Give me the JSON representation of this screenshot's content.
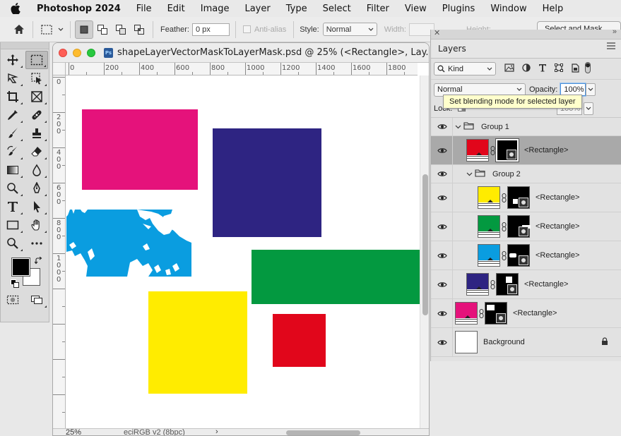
{
  "menubar": {
    "app_name": "Photoshop 2024",
    "items": [
      "File",
      "Edit",
      "Image",
      "Layer",
      "Type",
      "Select",
      "Filter",
      "View",
      "Plugins",
      "Window",
      "Help"
    ]
  },
  "options_bar": {
    "feather_label": "Feather:",
    "feather_value": "0 px",
    "antialias_label": "Anti-alias",
    "style_label": "Style:",
    "style_value": "Normal",
    "width_label": "Width:",
    "height_label": "Height:",
    "select_mask_label": "Select and Mask..."
  },
  "document": {
    "title": "shapeLayerVectorMaskToLayerMask.psd @ 25% (<Rectangle>, Lay...",
    "zoom": "25%",
    "color_profile": "eciRGB v2 (8bpc)",
    "ruler_h": [
      "0",
      "200",
      "400",
      "600",
      "800",
      "1000",
      "1200",
      "1400",
      "1600",
      "1800"
    ],
    "ruler_v": [
      "0",
      "2",
      "0",
      "0",
      "4",
      "0",
      "0",
      "6",
      "0",
      "0",
      "8",
      "0",
      "0",
      "1",
      "0",
      "0",
      "0"
    ],
    "colors": {
      "magenta": "#e5127b",
      "navy": "#2e2482",
      "cyan": "#0a9de0",
      "green": "#039940",
      "yellow": "#ffec00",
      "red": "#e1061b"
    }
  },
  "layers_panel": {
    "tab_title": "Layers",
    "filter_kind": "Kind",
    "blend_mode": "Normal",
    "opacity_label": "Opacity:",
    "opacity_value": "100%",
    "lock_label": "Lock:",
    "fill_value": "100%",
    "tooltip": "Set blending mode for selected layer",
    "layers": [
      {
        "name": "Group 1",
        "type": "group",
        "indent": 0,
        "selected": false
      },
      {
        "name": "<Rectangle>",
        "type": "shape",
        "color": "#e1061b",
        "indent": 1,
        "selected": true
      },
      {
        "name": "Group 2",
        "type": "group",
        "indent": 1,
        "selected": false
      },
      {
        "name": "<Rectangle>",
        "type": "shape",
        "color": "#ffec00",
        "indent": 2,
        "selected": false
      },
      {
        "name": "<Rectangle>",
        "type": "shape",
        "color": "#039940",
        "indent": 2,
        "selected": false
      },
      {
        "name": "<Rectangle>",
        "type": "shape",
        "color": "#0a9de0",
        "indent": 2,
        "selected": false
      },
      {
        "name": "<Rectangle>",
        "type": "shape",
        "color": "#2e2482",
        "indent": 1,
        "selected": false
      },
      {
        "name": "<Rectangle>",
        "type": "shape",
        "color": "#e5127b",
        "indent": 0,
        "selected": false
      },
      {
        "name": "Background",
        "type": "background",
        "indent": 0,
        "selected": false
      }
    ]
  }
}
